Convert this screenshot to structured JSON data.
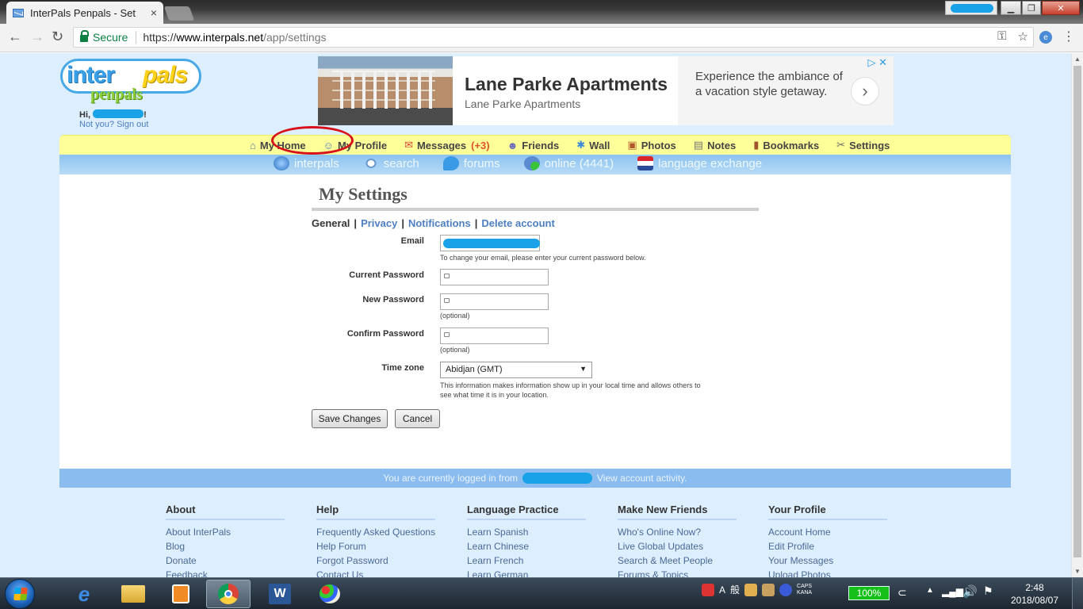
{
  "browser": {
    "tab_title": "InterPals Penpals - Set",
    "tab_close": "×",
    "secure_label": "Secure",
    "url_scheme": "https://",
    "url_host": "www.interpals.net",
    "url_path": "/app/settings",
    "back": "←",
    "forward": "→",
    "reload": "↻",
    "key": "⚿",
    "star": "☆",
    "menu": "⋮",
    "win_min": "▁",
    "win_max": "❐",
    "win_close": "✕"
  },
  "header": {
    "logo_inter": "inter",
    "logo_pals": "pals",
    "logo_penpals": "penpals",
    "greeting_prefix": "Hi,",
    "greeting_suffix": "!",
    "not_you": "Not you? Sign out"
  },
  "ad": {
    "headline": "Lane Parke Apartments",
    "subline": "Lane Parke Apartments",
    "copy": "Experience the ambiance of a vacation style getaway.",
    "arrow": "›",
    "choices": "▷ ✕"
  },
  "nav": {
    "items": [
      {
        "label": "My Home",
        "icon": "house-icon",
        "glyph": "⌂"
      },
      {
        "label": "My Profile",
        "icon": "profile-icon",
        "glyph": "☺"
      },
      {
        "label": "Messages",
        "count": "(+3)",
        "icon": "envelope-icon",
        "glyph": "✉"
      },
      {
        "label": "Friends",
        "icon": "friends-icon",
        "glyph": "☻"
      },
      {
        "label": "Wall",
        "icon": "wall-icon",
        "glyph": "✱"
      },
      {
        "label": "Photos",
        "icon": "photos-icon",
        "glyph": "▣"
      },
      {
        "label": "Notes",
        "icon": "notes-icon",
        "glyph": "▤"
      },
      {
        "label": "Bookmarks",
        "icon": "bookmarks-icon",
        "glyph": "▮"
      },
      {
        "label": "Settings",
        "icon": "settings-icon",
        "glyph": "✂"
      }
    ]
  },
  "subnav": {
    "items": [
      {
        "label": "interpals",
        "icon": "globe-icon"
      },
      {
        "label": "search",
        "icon": "magnifier-icon"
      },
      {
        "label": "forums",
        "icon": "chat-icon"
      },
      {
        "label": "online (4441)",
        "icon": "online-users-icon"
      },
      {
        "label": "language exchange",
        "icon": "flag-icon"
      }
    ]
  },
  "settings": {
    "title": "My Settings",
    "tabs": {
      "general": "General",
      "privacy": "Privacy",
      "notifications": "Notifications",
      "delete": "Delete account",
      "sep": "|"
    },
    "email_label": "Email",
    "email_hint": "To change your email, please enter your current password below.",
    "current_password_label": "Current Password",
    "new_password_label": "New Password",
    "new_password_hint": "(optional)",
    "confirm_password_label": "Confirm Password",
    "confirm_password_hint": "(optional)",
    "timezone_label": "Time zone",
    "timezone_value": "Abidjan (GMT)",
    "timezone_hint": "This information makes information show up in your local time and allows others to see what time it is in your location.",
    "save_button": "Save Changes",
    "cancel_button": "Cancel"
  },
  "footer": {
    "logged_in_prefix": "You are currently logged in from",
    "view_activity": "View account activity.",
    "columns": [
      {
        "title": "About",
        "links": [
          "About InterPals",
          "Blog",
          "Donate",
          "Feedback"
        ]
      },
      {
        "title": "Help",
        "links": [
          "Frequently Asked Questions",
          "Help Forum",
          "Forgot Password",
          "Contact Us"
        ]
      },
      {
        "title": "Language Practice",
        "links": [
          "Learn Spanish",
          "Learn Chinese",
          "Learn French",
          "Learn German"
        ]
      },
      {
        "title": "Make New Friends",
        "links": [
          "Who's Online Now?",
          "Live Global Updates",
          "Search & Meet People",
          "Forums & Topics"
        ]
      },
      {
        "title": "Your Profile",
        "links": [
          "Account Home",
          "Edit Profile",
          "Your Messages",
          "Upload Photos"
        ]
      }
    ]
  },
  "taskbar": {
    "ime_a": "A",
    "ime_mode": "般",
    "caps": "CAPS",
    "kana": "KANA",
    "battery": "100%",
    "time": "2:48",
    "date": "2018/08/07"
  }
}
